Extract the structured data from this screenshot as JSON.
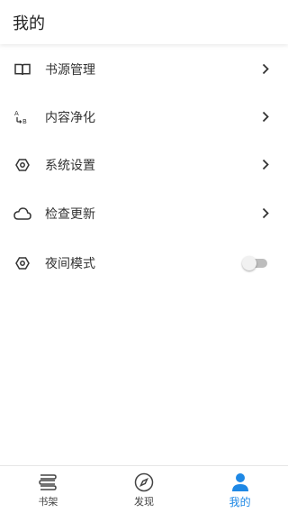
{
  "header": {
    "title": "我的"
  },
  "menu": {
    "items": [
      {
        "label": "书源管理",
        "icon": "book-open-icon",
        "has_chevron": true
      },
      {
        "label": "内容净化",
        "icon": "text-replace-icon",
        "has_chevron": true
      },
      {
        "label": "系统设置",
        "icon": "settings-icon",
        "has_chevron": true
      },
      {
        "label": "检查更新",
        "icon": "cloud-icon",
        "has_chevron": true
      },
      {
        "label": "夜间模式",
        "icon": "settings-icon",
        "toggle": false
      }
    ]
  },
  "bottom_nav": {
    "items": [
      {
        "label": "书架",
        "icon": "bookshelf-icon",
        "active": false
      },
      {
        "label": "发现",
        "icon": "compass-icon",
        "active": false
      },
      {
        "label": "我的",
        "icon": "person-icon",
        "active": true
      }
    ]
  },
  "colors": {
    "accent": "#1e88e5",
    "text": "#333333",
    "icon": "#333333",
    "toggle_track": "#bdbdbd",
    "toggle_thumb": "#f1f1f1"
  }
}
